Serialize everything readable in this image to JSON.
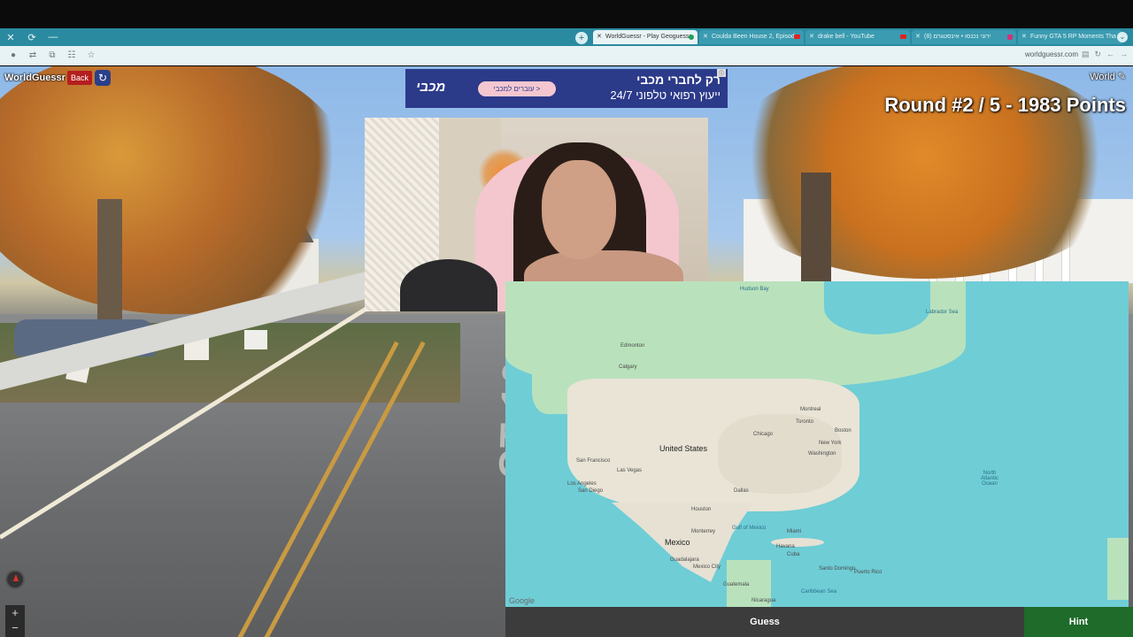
{
  "browser": {
    "tabs": [
      {
        "label": "WorldGuessr - Play Geoguessr",
        "active": true
      },
      {
        "label": "Coulda Been House 2, Episode",
        "active": false
      },
      {
        "label": "drake bell - YouTube",
        "active": false
      },
      {
        "label": "(8) ירוני נכנסו • אינסטגרם",
        "active": false
      },
      {
        "label": "Funny GTA 5 RP Moments Tha",
        "active": false
      }
    ],
    "url": "worldguessr.com"
  },
  "game": {
    "brand": "WorldGuessr",
    "back_label": "Back",
    "world_label": "World",
    "round_text": "Round #2 / 5 - 1983 Points",
    "guess_label": "Guess",
    "hint_label": "Hint",
    "road_marking": "CT-10"
  },
  "ad": {
    "logo": "מכבי",
    "cta": "עוברים למכבי >",
    "headline": "רק לחברי מכבי",
    "subline": "ייעוץ רפואי טלפוני 24/7"
  },
  "map": {
    "labels": {
      "us": "United States",
      "mexico": "Mexico",
      "calgary": "Calgary",
      "edmonton": "Edmonton",
      "chicago": "Chicago",
      "toronto": "Toronto",
      "montreal": "Montreal",
      "boston": "Boston",
      "newyork": "New York",
      "washington": "Washington",
      "sanfrancisco": "San Francisco",
      "losangeles": "Los Angeles",
      "sandiego": "San Diego",
      "lasvegas": "Las Vegas",
      "dallas": "Dallas",
      "houston": "Houston",
      "miami": "Miami",
      "monterrey": "Monterrey",
      "guadalajara": "Guadalajara",
      "mexicocity": "Mexico City",
      "havana": "Havana",
      "cuba": "Cuba",
      "guatemala": "Guatemala",
      "nicaragua": "Nicaragua",
      "puertorico": "Puerto Rico",
      "domingo": "Santo Domingo",
      "gulf": "Gulf of Mexico",
      "atlantic": "North Atlantic Ocean",
      "hudson": "Hudson Bay",
      "labrador": "Labrador Sea",
      "caribbean": "Caribbean Sea",
      "attribution": "Google"
    }
  }
}
